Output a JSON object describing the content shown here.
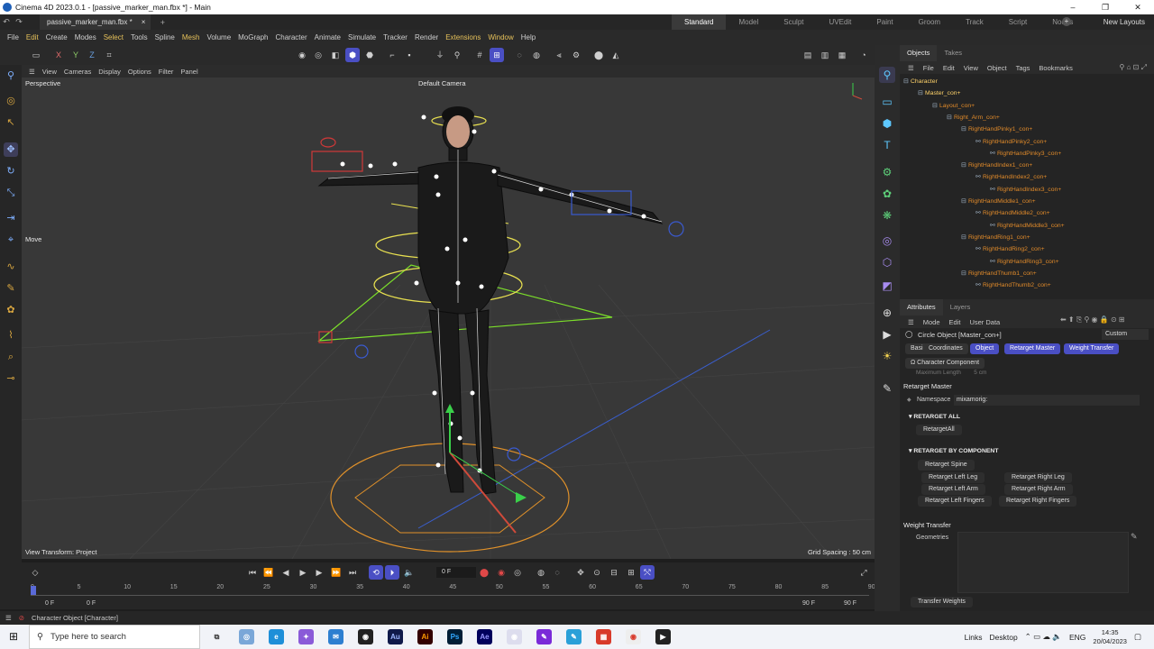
{
  "window": {
    "title": "Cinema 4D 2023.0.1 - [passive_marker_man.fbx *] - Main",
    "controls": [
      "–",
      "❐",
      "✕"
    ]
  },
  "tabs": {
    "document": "passive_marker_man.fbx *",
    "close": "×",
    "add": "+",
    "layouts": [
      "Standard",
      "Model",
      "Sculpt",
      "UVEdit",
      "Paint",
      "Groom",
      "Track",
      "Script",
      "Nodes"
    ],
    "active_layout": "Standard",
    "new_layouts": "New Layouts"
  },
  "menu": [
    "File",
    "Edit",
    "Create",
    "Modes",
    "Select",
    "Tools",
    "Spline",
    "Mesh",
    "Volume",
    "MoGraph",
    "Character",
    "Animate",
    "Simulate",
    "Tracker",
    "Render",
    "Extensions",
    "Window",
    "Help"
  ],
  "menu_highlighted": [
    "Edit",
    "Select",
    "Mesh",
    "Extensions",
    "Window"
  ],
  "toolbar": {
    "axis_labels": [
      "X",
      "Y",
      "Z"
    ]
  },
  "viewport": {
    "menu": [
      "View",
      "Cameras",
      "Display",
      "Options",
      "Filter",
      "Panel"
    ],
    "projection": "Perspective",
    "camera": "Default Camera",
    "tool_label": "Move",
    "view_transform": "View Transform: Project",
    "grid_spacing": "Grid Spacing : 50 cm"
  },
  "timeline": {
    "current_frame": "0 F",
    "ticks": [
      "0",
      "5",
      "10",
      "15",
      "20",
      "25",
      "30",
      "35",
      "40",
      "45",
      "50",
      "55",
      "60",
      "65",
      "70",
      "75",
      "80",
      "85",
      "90"
    ],
    "start_frame": "0 F",
    "preview_start": "0 F",
    "preview_end": "90 F",
    "end_frame": "90 F"
  },
  "status": {
    "text": "Character Object [Character]"
  },
  "objects_panel": {
    "tabs": [
      "Objects",
      "Takes"
    ],
    "menu": [
      "File",
      "Edit",
      "View",
      "Object",
      "Tags",
      "Bookmarks"
    ],
    "tree": [
      {
        "label": "Character",
        "level": 0
      },
      {
        "label": "Master_con+",
        "level": 1
      },
      {
        "label": "Layout_con+",
        "level": 2
      },
      {
        "label": "Right_Arm_con+",
        "level": 3
      },
      {
        "label": "RightHandPinky1_con+",
        "level": 4
      },
      {
        "label": "RightHandPinky2_con+",
        "level": 5
      },
      {
        "label": "RightHandPinky3_con+",
        "level": 6
      },
      {
        "label": "RightHandIndex1_con+",
        "level": 4
      },
      {
        "label": "RightHandIndex2_con+",
        "level": 5
      },
      {
        "label": "RightHandIndex3_con+",
        "level": 6
      },
      {
        "label": "RightHandMiddle1_con+",
        "level": 4
      },
      {
        "label": "RightHandMiddle2_con+",
        "level": 5
      },
      {
        "label": "RightHandMiddle3_con+",
        "level": 6
      },
      {
        "label": "RightHandRing1_con+",
        "level": 4
      },
      {
        "label": "RightHandRing2_con+",
        "level": 5
      },
      {
        "label": "RightHandRing3_con+",
        "level": 6
      },
      {
        "label": "RightHandThumb1_con+",
        "level": 4
      },
      {
        "label": "RightHandThumb2_con+",
        "level": 5
      }
    ]
  },
  "attributes_panel": {
    "tabs": [
      "Attributes",
      "Layers"
    ],
    "menu": [
      "Mode",
      "Edit",
      "User Data"
    ],
    "preset": "Custom",
    "object_title": "Circle Object [Master_con+]",
    "chips": [
      {
        "label": "Basic",
        "active": false
      },
      {
        "label": "Coordinates",
        "active": false
      },
      {
        "label": "Object",
        "active": true
      },
      {
        "label": "Retarget Master",
        "active": true
      },
      {
        "label": "Weight Transfer",
        "active": true
      }
    ],
    "component_chip": "Ω Character Component",
    "faded_row": "Maximum Length        5 cm",
    "retarget_master_title": "Retarget Master",
    "namespace_label": "Namespace",
    "namespace_value": "mixamorig:",
    "retarget_all_header": "RETARGET ALL",
    "retarget_all_button": "RetargetAll",
    "retarget_by_component_header": "RETARGET BY COMPONENT",
    "component_buttons": [
      "Retarget Spine",
      "Retarget Left Leg",
      "Retarget Right Leg",
      "Retarget Left Arm",
      "Retarget Right Arm",
      "Retarget Left Fingers",
      "Retarget Right Fingers"
    ],
    "weight_transfer_title": "Weight Transfer",
    "geometries_label": "Geometries",
    "transfer_weights_button": "Transfer Weights"
  },
  "taskbar": {
    "search_placeholder": "Type here to search",
    "tray": [
      "Links",
      "Desktop",
      "ENG"
    ],
    "time": "14:35",
    "date": "20/04/2023"
  },
  "colors": {
    "accent": "#4a4fc4",
    "viewport_bg": "#383838",
    "tree_text": "#e08a2a",
    "tree_selected": "#ffd36a"
  }
}
